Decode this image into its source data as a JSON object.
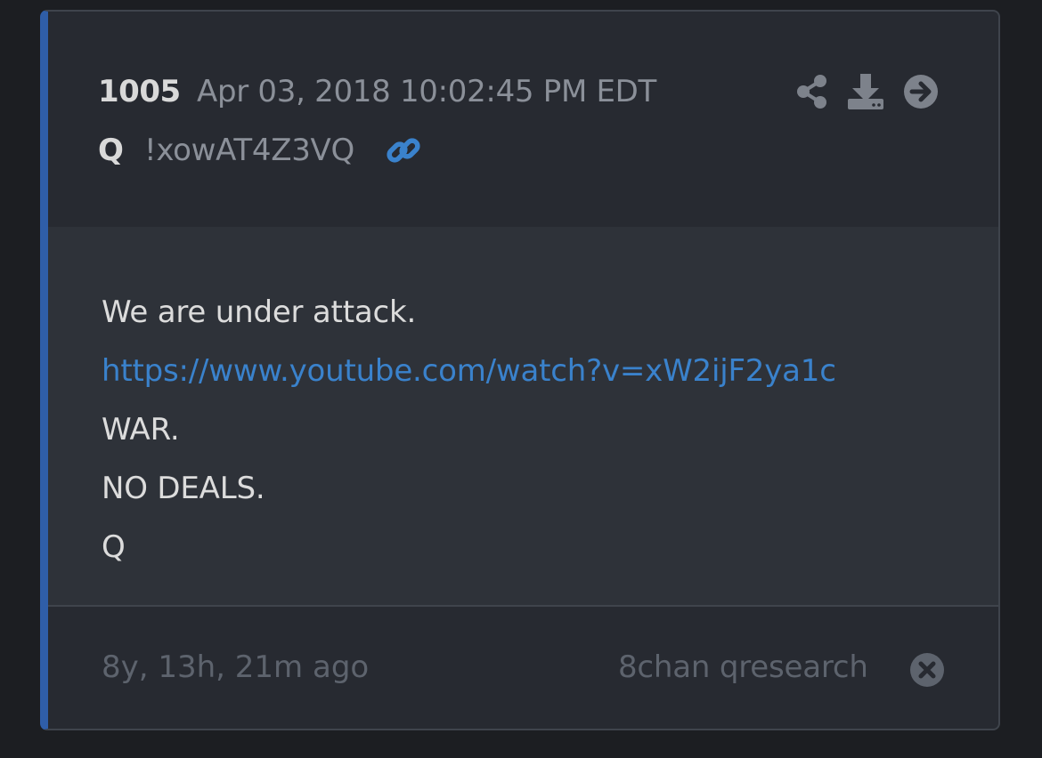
{
  "post": {
    "number": "1005",
    "date": "Apr 03, 2018 10:02:45 PM EDT",
    "author": "Q",
    "tripcode": "!xowAT4Z3VQ"
  },
  "icons": {
    "link": "link-icon",
    "share": "share-icon",
    "download": "download-icon",
    "navigate": "arrow-right-circle-icon",
    "close": "close-circle-icon"
  },
  "message": {
    "line1": "We are under attack.",
    "url": "https://www.youtube.com/watch?v=xW2ijF2ya1c",
    "line3": "WAR.",
    "line4": "NO DEALS.",
    "line5": "Q"
  },
  "footer": {
    "ago": "8y, 13h, 21m ago",
    "source": "8chan qresearch"
  },
  "colors": {
    "accent": "#2f5ea8",
    "link": "#3a82cc",
    "card": "#272a31",
    "body": "#2e3239"
  }
}
